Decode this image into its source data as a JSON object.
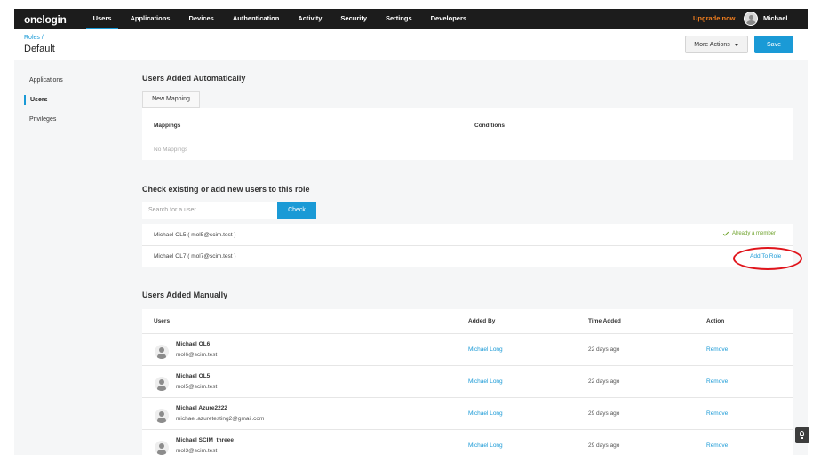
{
  "nav": {
    "logo": "onelogin",
    "items": [
      {
        "label": "Users",
        "active": true
      },
      {
        "label": "Applications"
      },
      {
        "label": "Devices"
      },
      {
        "label": "Authentication"
      },
      {
        "label": "Activity"
      },
      {
        "label": "Security"
      },
      {
        "label": "Settings"
      },
      {
        "label": "Developers"
      }
    ],
    "upgrade": "Upgrade now",
    "username": "Michael"
  },
  "header": {
    "breadcrumb": "Roles /",
    "title": "Default",
    "more_actions": "More Actions",
    "save": "Save"
  },
  "sidebar": {
    "items": [
      {
        "label": "Applications"
      },
      {
        "label": "Users",
        "active": true
      },
      {
        "label": "Privileges"
      }
    ]
  },
  "auto": {
    "title": "Users Added Automatically",
    "new_mapping": "New Mapping",
    "col_mappings": "Mappings",
    "col_conditions": "Conditions",
    "empty": "No Mappings"
  },
  "check": {
    "title": "Check existing or add new users to this role",
    "placeholder": "Search for a user",
    "button": "Check",
    "results": [
      {
        "text": "Michael OL5 ( mol5@scim.test )",
        "status": "Already a member"
      },
      {
        "text": "Michael OL7 ( mol7@scim.test )",
        "action": "Add To Role"
      }
    ]
  },
  "manual": {
    "title": "Users Added Manually",
    "columns": {
      "users": "Users",
      "added_by": "Added By",
      "time_added": "Time Added",
      "action": "Action"
    },
    "rows": [
      {
        "name": "Michael OL6",
        "email": "mol6@scim.test",
        "added_by": "Michael Long",
        "time": "22 days ago",
        "action": "Remove"
      },
      {
        "name": "Michael OL5",
        "email": "mol5@scim.test",
        "added_by": "Michael Long",
        "time": "22 days ago",
        "action": "Remove"
      },
      {
        "name": "Michael Azure2222",
        "email": "michael.azuretesting2@gmail.com",
        "added_by": "Michael Long",
        "time": "29 days ago",
        "action": "Remove"
      },
      {
        "name": "Michael SCIM_threee",
        "email": "mol3@scim.test",
        "added_by": "Michael Long",
        "time": "29 days ago",
        "action": "Remove"
      }
    ]
  },
  "colors": {
    "accent": "#1a9ad6",
    "upgrade": "#f07d1e",
    "success": "#6ea22b",
    "highlight": "#e0141b"
  },
  "icons": [
    "user-avatar-icon",
    "checkmark-icon",
    "chevron-down-icon",
    "lightbulb-icon"
  ]
}
